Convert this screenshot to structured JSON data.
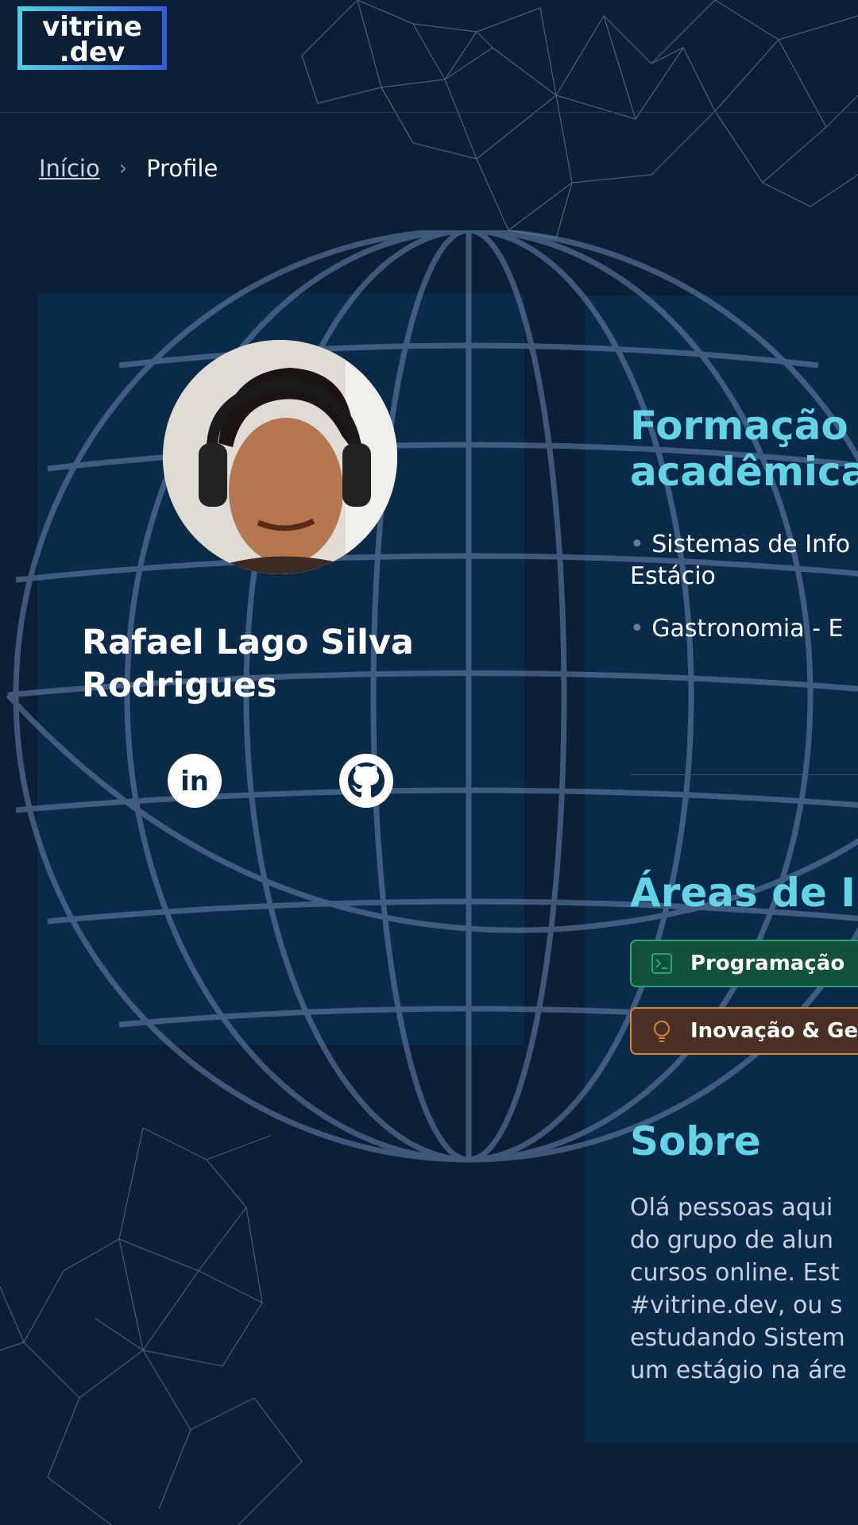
{
  "header": {
    "logo_line1": "vitrine",
    "logo_line2": ".dev"
  },
  "breadcrumb": {
    "home": "Início",
    "separator": "›",
    "current": "Profile"
  },
  "profile": {
    "name_line1": "Rafael Lago Silva",
    "name_line2": "Rodrigues",
    "social": [
      {
        "icon": "linkedin-icon",
        "label": "in"
      },
      {
        "icon": "github-icon"
      }
    ]
  },
  "education": {
    "title_line1": "Formação",
    "title_line2": "acadêmica",
    "items": [
      {
        "bullet": "•",
        "line1": "Sistemas de Info",
        "line2": "Estácio"
      },
      {
        "bullet": "•",
        "line1": "Gastronomia - E"
      }
    ]
  },
  "interests": {
    "title": "Áreas de In",
    "tags": [
      {
        "label": "Programação",
        "icon": "terminal-icon",
        "color": "#2aa36d"
      },
      {
        "label": "Inovação & Ge",
        "icon": "lightbulb-icon",
        "color": "#d6823b"
      }
    ]
  },
  "about": {
    "title": "Sobre",
    "lines": [
      "Olá pessoas aqui",
      "do grupo de alun",
      "cursos online. Est",
      "#vitrine.dev, ou s",
      "estudando Sistem",
      "um estágio na áre"
    ]
  },
  "colors": {
    "background": "#0b1f36",
    "card": "#0a2a4a",
    "accent": "#63d3e6"
  }
}
